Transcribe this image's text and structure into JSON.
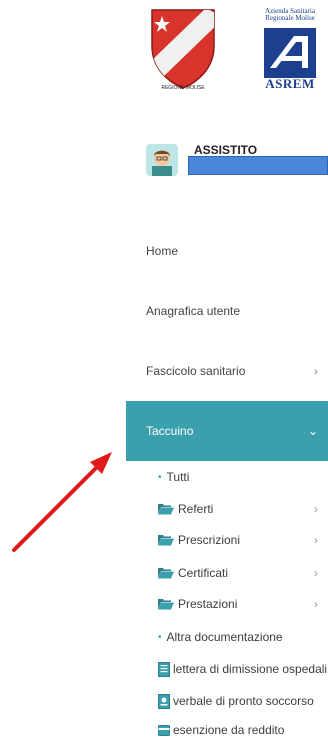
{
  "header": {
    "region_logo_text": "REGIONE MOLISE",
    "asrem_line1": "Azienda Sanitaria",
    "asrem_line2": "Regionale Molise",
    "asrem_word": "ASREM"
  },
  "user": {
    "label": "ASSISTITO"
  },
  "menu": {
    "home": "Home",
    "anagrafica": "Anagrafica utente",
    "fascicolo": "Fascicolo sanitario",
    "taccuino": "Taccuino"
  },
  "taccuino_items": [
    {
      "label": "Tutti"
    },
    {
      "label": "Referti"
    },
    {
      "label": "Prescrizioni"
    },
    {
      "label": "Certificati"
    },
    {
      "label": "Prestazioni"
    },
    {
      "label": "Altra documentazione"
    },
    {
      "label": "lettera di dimissione ospedali"
    },
    {
      "label": "verbale di pronto soccorso"
    },
    {
      "label": "esenzione da reddito"
    }
  ],
  "colors": {
    "accent": "#3aa0ae",
    "redacted_bar": "#4a86d8",
    "arrow": "#e01a1a"
  }
}
